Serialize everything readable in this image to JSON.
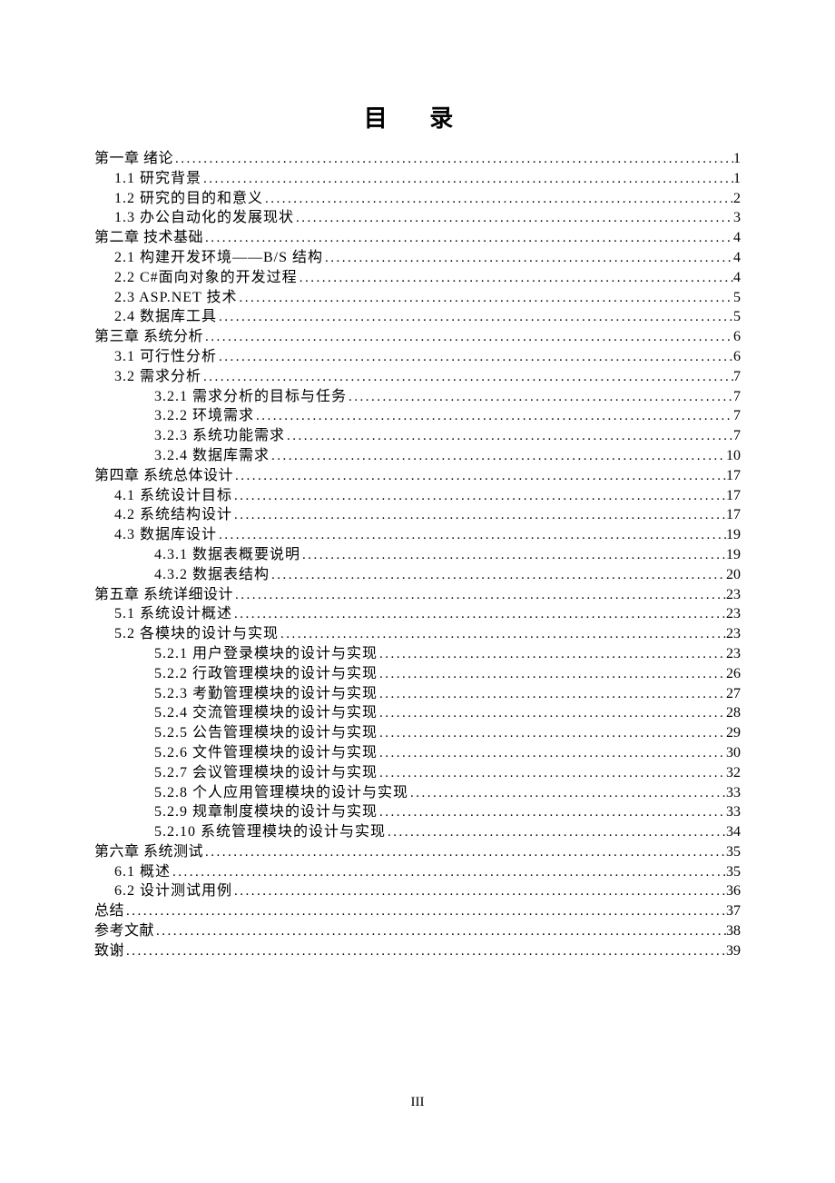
{
  "title": "目 录",
  "page_number": "III",
  "entries": [
    {
      "level": 0,
      "label": "第一章 绪论",
      "page": "1"
    },
    {
      "level": 1,
      "label": "1.1 研究背景",
      "page": "1"
    },
    {
      "level": 1,
      "label": "1.2 研究的目的和意义",
      "page": "2"
    },
    {
      "level": 1,
      "label": "1.3 办公自动化的发展现状",
      "page": "3"
    },
    {
      "level": 0,
      "label": "第二章 技术基础",
      "page": "4"
    },
    {
      "level": 1,
      "label": "2.1 构建开发环境——B/S 结构",
      "page": "4"
    },
    {
      "level": 1,
      "label": "2.2 C#面向对象的开发过程",
      "page": "4"
    },
    {
      "level": 1,
      "label": "2.3 ASP.NET 技术",
      "page": "5"
    },
    {
      "level": 1,
      "label": "2.4 数据库工具",
      "page": "5"
    },
    {
      "level": 0,
      "label": "第三章 系统分析",
      "page": "6"
    },
    {
      "level": 1,
      "label": "3.1 可行性分析",
      "page": "6"
    },
    {
      "level": 1,
      "label": "3.2 需求分析",
      "page": "7"
    },
    {
      "level": 2,
      "label": "3.2.1 需求分析的目标与任务",
      "page": "7"
    },
    {
      "level": 2,
      "label": "3.2.2 环境需求",
      "page": "7"
    },
    {
      "level": 2,
      "label": "3.2.3 系统功能需求",
      "page": "7"
    },
    {
      "level": 2,
      "label": "3.2.4 数据库需求",
      "page": "10"
    },
    {
      "level": 0,
      "label": "第四章 系统总体设计",
      "page": "17"
    },
    {
      "level": 1,
      "label": "4.1 系统设计目标",
      "page": "17"
    },
    {
      "level": 1,
      "label": "4.2 系统结构设计",
      "page": "17"
    },
    {
      "level": 1,
      "label": "4.3 数据库设计",
      "page": "19"
    },
    {
      "level": 2,
      "label": "4.3.1 数据表概要说明",
      "page": "19"
    },
    {
      "level": 2,
      "label": "4.3.2 数据表结构",
      "page": "20"
    },
    {
      "level": 0,
      "label": "第五章 系统详细设计",
      "page": "23"
    },
    {
      "level": 1,
      "label": "5.1 系统设计概述",
      "page": "23"
    },
    {
      "level": 1,
      "label": "5.2 各模块的设计与实现",
      "page": "23"
    },
    {
      "level": 2,
      "label": "5.2.1 用户登录模块的设计与实现",
      "page": "23"
    },
    {
      "level": 2,
      "label": "5.2.2 行政管理模块的设计与实现",
      "page": "26"
    },
    {
      "level": 2,
      "label": "5.2.3 考勤管理模块的设计与实现",
      "page": "27"
    },
    {
      "level": 2,
      "label": "5.2.4 交流管理模块的设计与实现",
      "page": "28"
    },
    {
      "level": 2,
      "label": "5.2.5 公告管理模块的设计与实现",
      "page": "29"
    },
    {
      "level": 2,
      "label": "5.2.6 文件管理模块的设计与实现",
      "page": "30"
    },
    {
      "level": 2,
      "label": "5.2.7 会议管理模块的设计与实现",
      "page": "32"
    },
    {
      "level": 2,
      "label": "5.2.8 个人应用管理模块的设计与实现",
      "page": "33"
    },
    {
      "level": 2,
      "label": "5.2.9 规章制度模块的设计与实现",
      "page": "33"
    },
    {
      "level": 2,
      "label": "5.2.10 系统管理模块的设计与实现",
      "page": "34"
    },
    {
      "level": 0,
      "label": "第六章 系统测试",
      "page": "35"
    },
    {
      "level": 1,
      "label": "6.1 概述",
      "page": "35"
    },
    {
      "level": 1,
      "label": "6.2 设计测试用例",
      "page": "36"
    },
    {
      "level": 0,
      "label": "总结",
      "page": "37"
    },
    {
      "level": 0,
      "label": "参考文献",
      "page": "38"
    },
    {
      "level": 0,
      "label": "致谢",
      "page": "39"
    }
  ]
}
